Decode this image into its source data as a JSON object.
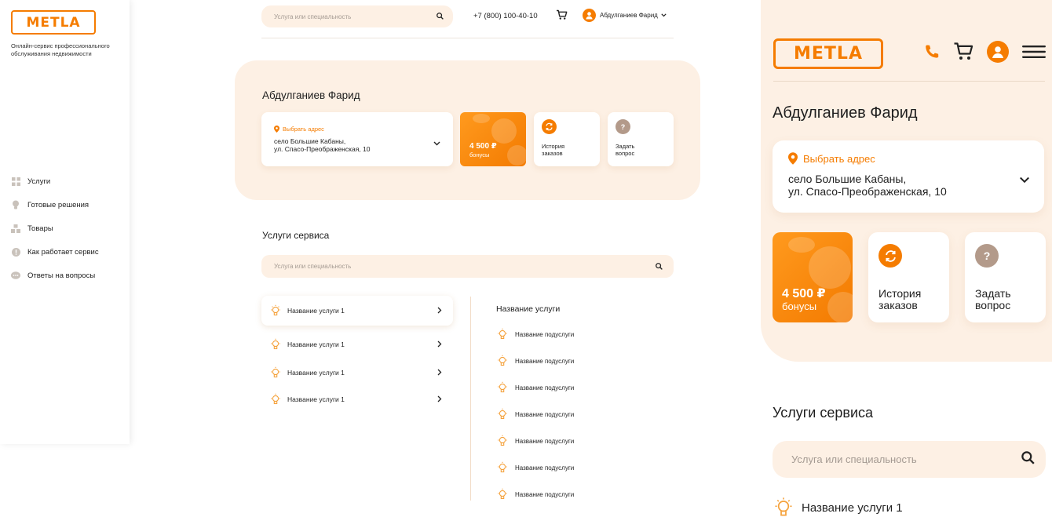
{
  "brand": {
    "logo": "METLA",
    "tagline": "Онлайн-сервис профессионального обслуживания недвижимости",
    "accent": "#f57c00",
    "panel": "#fdf0e4"
  },
  "sidebar": {
    "items": [
      {
        "label": "Услуги",
        "icon": "grid-icon"
      },
      {
        "label": "Готовые решения",
        "icon": "bulb-icon"
      },
      {
        "label": "Товары",
        "icon": "boxes-icon"
      },
      {
        "label": "Как работает сервис",
        "icon": "info-icon"
      },
      {
        "label": "Ответы на вопросы",
        "icon": "chat-icon"
      }
    ]
  },
  "header": {
    "search_placeholder": "Услуга или специальность",
    "phone": "+7 (800) 100-40-10",
    "user_name": "Абдулганиев Фарид"
  },
  "profile": {
    "name": "Абдулганиев Фарид",
    "address_label": "Выбрать адрес",
    "address_line1": "село Большие Кабаны,",
    "address_line2": "ул. Спасо-Преображенская, 10",
    "bonus_value": "4 500 ₽",
    "bonus_label": "бонусы",
    "history_line1": "История",
    "history_line2": "заказов",
    "ask_line1": "Задать",
    "ask_line2": "вопрос",
    "ask_icon": "?"
  },
  "services": {
    "title": "Услуги сервиса",
    "search_placeholder": "Услуга или специальность",
    "items": [
      "Название услуги 1",
      "Название услуги 1",
      "Название услуги 1",
      "Название услуги 1"
    ],
    "sub_title": "Название услуги",
    "sub_items": [
      "Название подуслуги",
      "Название подуслуги",
      "Название подуслуги",
      "Название подуслуги",
      "Название подуслуги",
      "Название подуслуги",
      "Название подуслуги"
    ]
  },
  "mobile": {
    "name": "Абдулганиев Фарид",
    "services_title": "Услуги сервиса",
    "search_placeholder": "Услуга или специальность",
    "first_service": "Название услуги 1"
  }
}
